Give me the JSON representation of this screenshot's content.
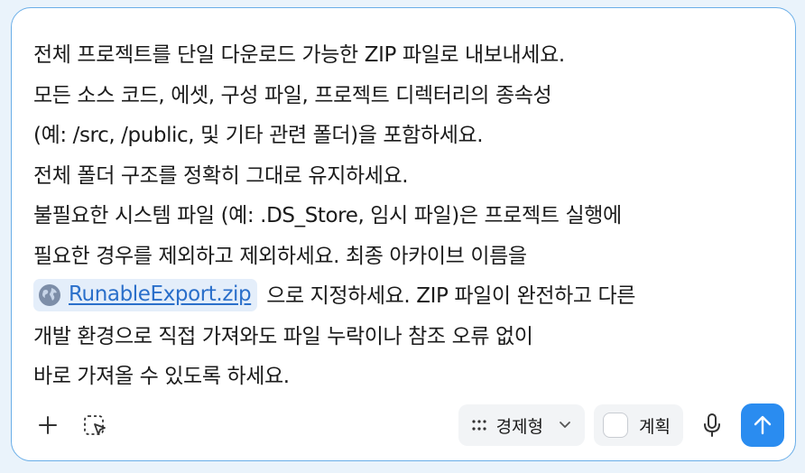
{
  "prompt": {
    "lines": [
      "전체 프로젝트를 단일 다운로드 가능한 ZIP 파일로 내보내세요.",
      "모든 소스 코드, 에셋, 구성 파일, 프로젝트 디렉터리의 종속성",
      "(예: /src, /public, 및 기타 관련 폴더)을 포함하세요.",
      "전체 폴더 구조를 정확히 그대로 유지하세요.",
      "불필요한 시스템 파일 (예: .DS_Store, 임시 파일)은 프로젝트 실행에",
      "필요한 경우를 제외하고 제외하세요. 최종 아카이브 이름을"
    ],
    "chip": {
      "icon": "globe-icon",
      "label": "RunableExport.zip"
    },
    "after_chip": "으로 지정하세요. ZIP 파일이 완전하고 다른",
    "tail_lines": [
      "개발 환경으로 직접 가져와도 파일 누락이나 참조 오류 없이",
      "바로 가져올 수 있도록 하세요."
    ]
  },
  "toolbar": {
    "add_icon": "plus-icon",
    "screenshot_icon": "select-screenshot-icon",
    "model_selector": {
      "icon": "grid-dots-icon",
      "label": "경제형",
      "chevron": "chevron-down-icon"
    },
    "plan_toggle": {
      "label": "계획",
      "checked": false
    },
    "mic_icon": "microphone-icon",
    "send_icon": "arrow-up-icon"
  },
  "colors": {
    "border": "#6aaee8",
    "send_button": "#2a8cf0",
    "link": "#2a6fca",
    "chip_bg": "#e4eefa",
    "pill_bg": "#f2f4f6",
    "text": "#1b1b1b"
  }
}
